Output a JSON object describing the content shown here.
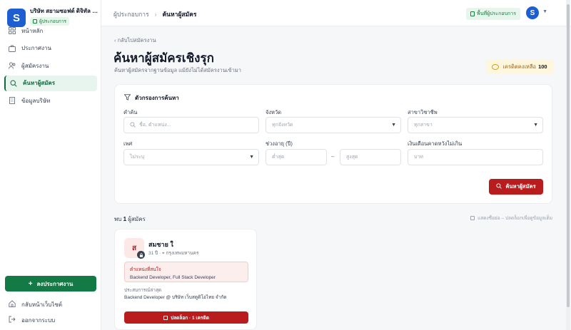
{
  "brand": {
    "name": "บริษัท สยามซอฟต์ ดิจิทัล จำกัด",
    "badge": "ผู้ประกอบการ",
    "logo_letter": "S"
  },
  "sidebar": {
    "items": [
      {
        "label": "หน้าหลัก",
        "icon": "grid-icon"
      },
      {
        "label": "ประกาศงาน",
        "icon": "briefcase-icon"
      },
      {
        "label": "ผู้สมัครงาน",
        "icon": "users-icon"
      },
      {
        "label": "ค้นหาผู้สมัคร",
        "icon": "search-icon"
      },
      {
        "label": "ข้อมูลบริษัท",
        "icon": "building-icon"
      }
    ],
    "post_job_label": "ลงประกาศงาน",
    "footer": [
      {
        "label": "กลับหน้าเว็บไซต์",
        "icon": "home-icon"
      },
      {
        "label": "ออกจากระบบ",
        "icon": "logout-icon"
      }
    ]
  },
  "topbar": {
    "breadcrumb_parent": "ผู้ประกอบการ",
    "breadcrumb_current": "ค้นหาผู้สมัคร",
    "workspace_label": "พื้นที่ผู้ประกอบการ",
    "avatar_letter": "S"
  },
  "page": {
    "back_label": "กลับไปสมัครงาน",
    "title": "ค้นหาผู้สมัครเชิงรุก",
    "subtitle": "ค้นหาผู้สมัครจากฐานข้อมูล แม้ยังไม่ได้สมัครงานเข้ามา",
    "credit_label": "เครดิตคงเหลือ",
    "credit_value": "100"
  },
  "filters": {
    "heading": "ตัวกรองการค้นหา",
    "keyword": {
      "label": "คำค้น",
      "placeholder": "ชื่อ, ตำแหน่ง..."
    },
    "province": {
      "label": "จังหวัด",
      "value": "ทุกจังหวัด"
    },
    "field_of_study": {
      "label": "สาขาวิชาชีพ",
      "value": "ทุกสาขา"
    },
    "gender": {
      "label": "เพศ",
      "value": "ไม่ระบุ"
    },
    "age": {
      "label": "ช่วงอายุ (ปี)",
      "min_placeholder": "ต่ำสุด",
      "max_placeholder": "สูงสุด",
      "separator": "–"
    },
    "salary": {
      "label": "เงินเดือนคาดหวังไม่เกิน",
      "placeholder": "บาท"
    },
    "search_button": "ค้นหาผู้สมัคร"
  },
  "results": {
    "found_prefix": "พบ",
    "found_count": "1",
    "found_suffix": "ผู้สมัคร",
    "hint": "แสดงชื่อย่อ – ปลดล็อกเพื่อดูข้อมูลเต็ม",
    "candidates": [
      {
        "initial": "ส",
        "name": "สมชาย ใ",
        "age": "31 ปี",
        "location": "กรุงเทพมหานคร",
        "positions_label": "ตำแหน่งที่สนใจ",
        "positions": "Backend Developer, Full Stack Developer",
        "experience_label": "ประสบการณ์ล่าสุด",
        "experience": "Backend Developer @ บริษัท เว็บสตูดิโอไทย จำกัด",
        "unlock_label": "ปลดล็อก · 1 เครดิต"
      }
    ]
  }
}
